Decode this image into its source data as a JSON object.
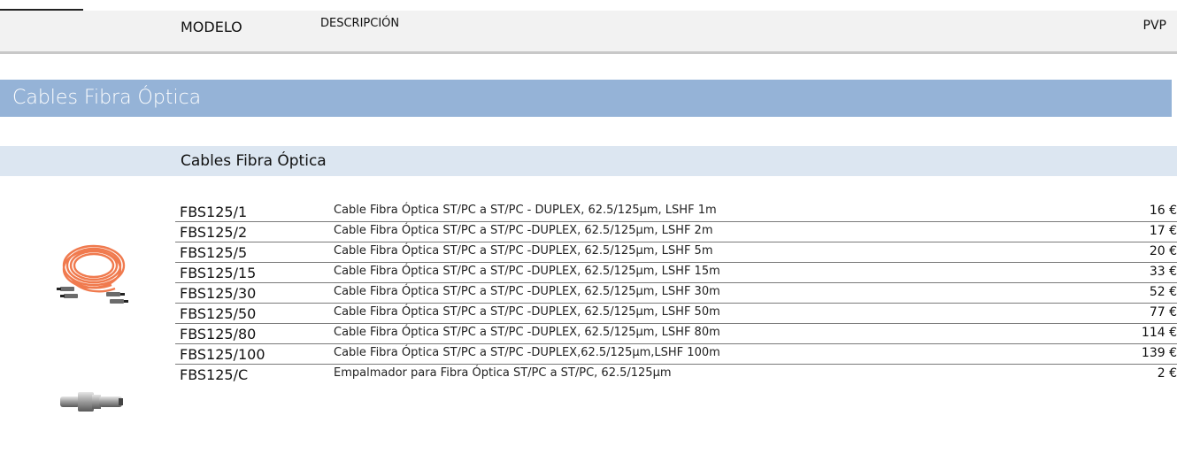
{
  "header": {
    "modelo": "MODELO",
    "descripcion": "DESCRIPCIÓN",
    "pvp": "PVP"
  },
  "section": {
    "title": "Cables Fibra Óptica"
  },
  "subsection": {
    "title": "Cables Fibra Óptica"
  },
  "products": [
    {
      "model": "FBS125/1",
      "description": "Cable Fibra Óptica ST/PC a ST/PC - DUPLEX, 62.5/125µm, LSHF 1m",
      "price": "16 €"
    },
    {
      "model": "FBS125/2",
      "description": "Cable Fibra Óptica ST/PC a ST/PC -DUPLEX, 62.5/125µm, LSHF 2m",
      "price": "17 €"
    },
    {
      "model": "FBS125/5",
      "description": "Cable Fibra Óptica ST/PC a ST/PC -DUPLEX, 62.5/125µm, LSHF 5m",
      "price": "20 €"
    },
    {
      "model": "FBS125/15",
      "description": "Cable Fibra Óptica ST/PC a ST/PC -DUPLEX, 62.5/125µm, LSHF 15m",
      "price": "33 €"
    },
    {
      "model": "FBS125/30",
      "description": "Cable Fibra Óptica ST/PC a ST/PC -DUPLEX, 62.5/125µm, LSHF 30m",
      "price": "52 €"
    },
    {
      "model": "FBS125/50",
      "description": "Cable Fibra Óptica ST/PC a ST/PC -DUPLEX, 62.5/125µm, LSHF 50m",
      "price": "77 €"
    },
    {
      "model": "FBS125/80",
      "description": "Cable Fibra Óptica ST/PC a ST/PC -DUPLEX, 62.5/125µm, LSHF 80m",
      "price": "114 €"
    },
    {
      "model": "FBS125/100",
      "description": "Cable Fibra Óptica ST/PC a ST/PC -DUPLEX,62.5/125µm,LSHF 100m",
      "price": "139 €"
    },
    {
      "model": "FBS125/C",
      "description": "Empalmador  para  Fibra Óptica ST/PC a ST/PC, 62.5/125µm",
      "price": "2 €"
    }
  ],
  "colors": {
    "section_bar": "#95b3d7",
    "subsection_bar": "#dce6f1",
    "header_bar": "#f2f2f2",
    "cable": "#f07a4e"
  },
  "images": {
    "cable": "orange-fiber-cable-coil",
    "connector": "st-fiber-coupler"
  }
}
